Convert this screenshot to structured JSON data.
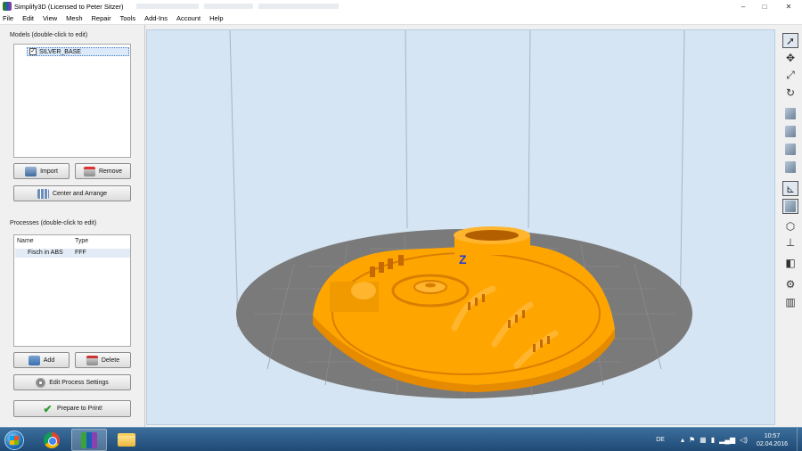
{
  "window": {
    "title": "Simplify3D (Licensed to Peter Sitzer)",
    "controls": {
      "minimize": "–",
      "maximize": "□",
      "close": "✕"
    }
  },
  "menu": [
    "File",
    "Edit",
    "View",
    "Mesh",
    "Repair",
    "Tools",
    "Add-Ins",
    "Account",
    "Help"
  ],
  "models": {
    "title": "Models (double-click to edit)",
    "items": [
      {
        "name": "SILVER_BASE",
        "checked": "✓"
      }
    ],
    "import_label": "Import",
    "remove_label": "Remove",
    "center_label": "Center and Arrange"
  },
  "processes": {
    "title": "Processes (double-click to edit)",
    "col_name": "Name",
    "col_type": "Type",
    "rows": [
      {
        "name": "Fisch in ABS",
        "type": "FFF"
      }
    ],
    "add_label": "Add",
    "delete_label": "Delete",
    "edit_label": "Edit Process Settings",
    "prepare_label": "Prepare to Print!"
  },
  "viewport": {
    "axis_label": "Z",
    "model_color": "#ffa500",
    "bed_color": "#7a7a7a",
    "background": "#d6e5f3"
  },
  "right_toolbar": [
    "select-icon",
    "move-icon",
    "scale-icon",
    "rotate-icon",
    "view-top-icon",
    "view-front-icon",
    "view-side-icon",
    "view-iso-icon",
    "axes-icon",
    "solid-view-icon",
    "wireframe-view-icon",
    "axis-z-icon",
    "cross-section-icon",
    "settings-icon",
    "supports-icon"
  ],
  "taskbar": {
    "language": "DE",
    "time": "10:57",
    "date": "02.04.2016"
  }
}
